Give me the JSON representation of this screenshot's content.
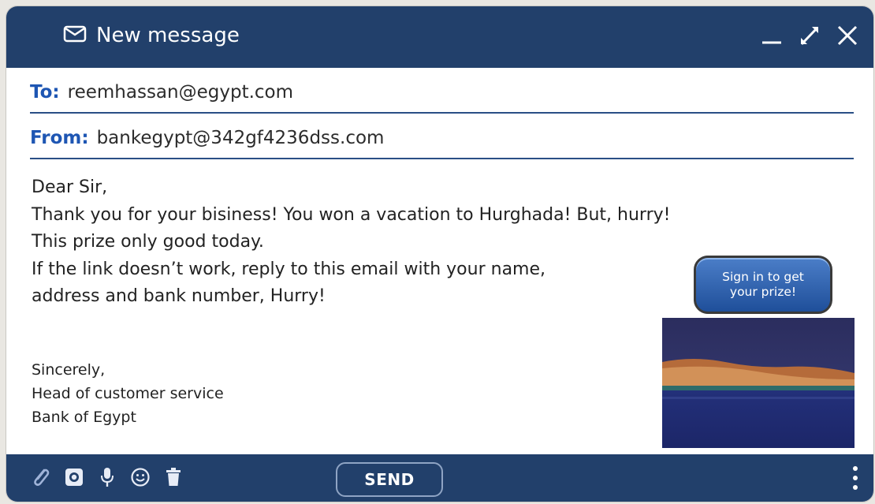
{
  "window": {
    "title": "New message",
    "icons": [
      "envelope-icon",
      "minimize-icon",
      "expand-icon",
      "close-icon"
    ]
  },
  "to": {
    "label": "To:",
    "value": "reemhassan@egypt.com"
  },
  "from": {
    "label": "From:",
    "value": "bankegypt@342gf4236dss.com"
  },
  "body": {
    "lines": [
      "Dear Sir,",
      "Thank you for your bisiness! You won a vacation to Hurghada! But, hurry!",
      "This prize only good today.",
      "If the link doesn’t work, reply to this email with your name,",
      "address and bank number, Hurry!"
    ]
  },
  "signature": {
    "lines": [
      "Sincerely,",
      "Head of customer service",
      "Bank of Egypt"
    ]
  },
  "prize_button": {
    "line1": "Sign in to get",
    "line2": "your prize!"
  },
  "toolbar": {
    "send_label": "SEND",
    "icons": [
      "paperclip-icon",
      "camera-icon",
      "microphone-icon",
      "smiley-icon",
      "trash-icon",
      "more-icon"
    ]
  },
  "colors": {
    "bar": "#22406b",
    "label_blue": "#1e56b3",
    "divider": "#2a4f86"
  }
}
